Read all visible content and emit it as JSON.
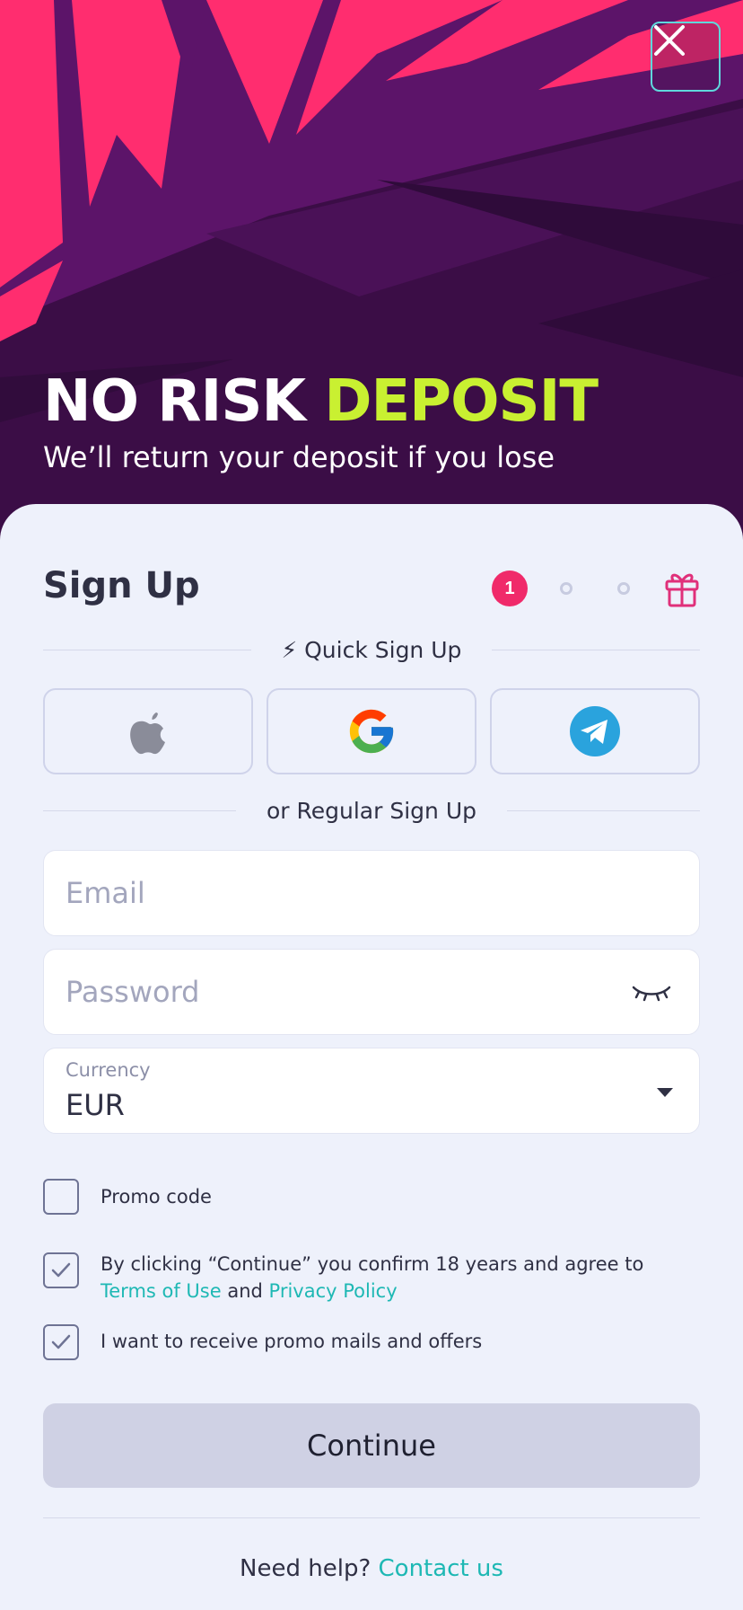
{
  "hero": {
    "title_main": "NO RISK ",
    "title_accent": "DEPOSIT",
    "subtitle": "We’ll return your deposit if you lose",
    "accent_color": "#c9f031",
    "close_icon": "close-icon"
  },
  "signup": {
    "title": "Sign Up",
    "current_step": "1",
    "steps_total": 3,
    "step_icon": "gift-icon",
    "quick_label": "⚡ Quick Sign Up",
    "social": [
      {
        "name": "apple-icon"
      },
      {
        "name": "google-icon"
      },
      {
        "name": "telegram-icon"
      }
    ],
    "regular_label": "or Regular Sign Up"
  },
  "form": {
    "email_placeholder": "Email",
    "password_placeholder": "Password",
    "password_toggle_icon": "eye-closed-icon",
    "currency_label": "Currency",
    "currency_value": "EUR",
    "promo_label": "Promo code",
    "promo_checked": false,
    "terms": {
      "prefix": "By clicking “Continue” you confirm 18 years and agree to ",
      "terms_link": "Terms of Use",
      "middle": " and ",
      "privacy_link": "Privacy Policy",
      "checked": true
    },
    "mails_label": "I want to receive promo mails and offers",
    "mails_checked": true,
    "continue_label": "Continue"
  },
  "footer": {
    "help_text": "Need help? ",
    "contact_link": "Contact us",
    "link_color": "#1eb8b4"
  }
}
